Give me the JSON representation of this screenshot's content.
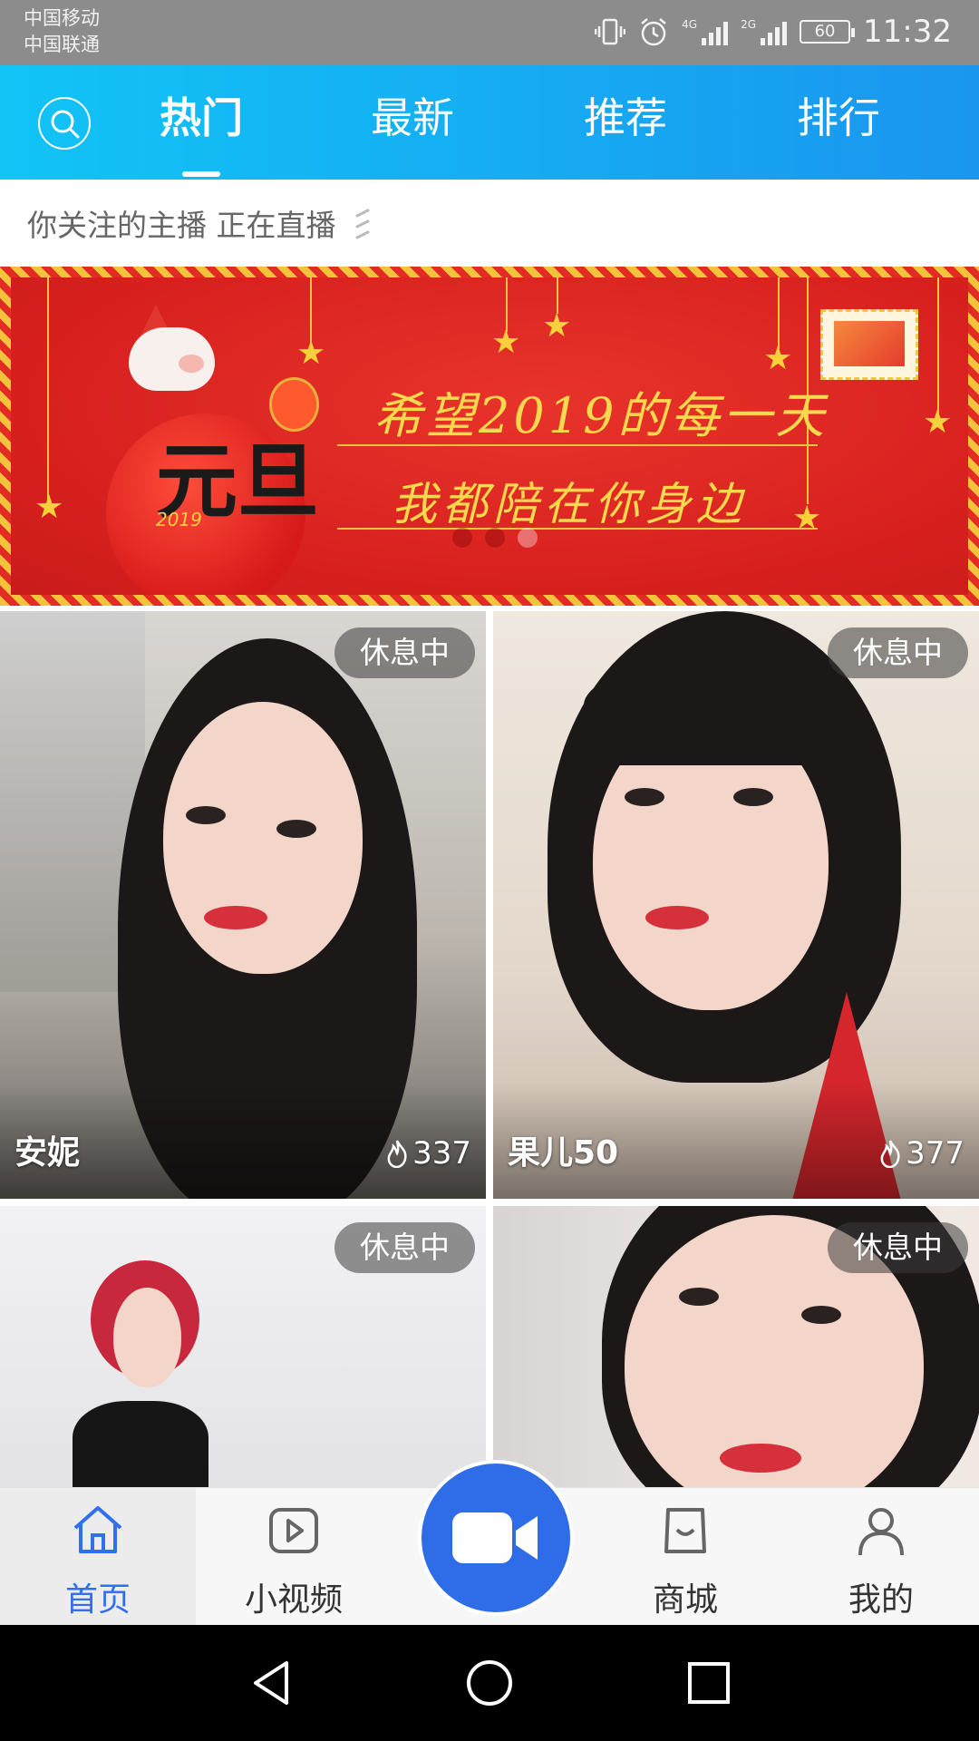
{
  "status_bar": {
    "carrier_1": "中国移动",
    "carrier_2": "中国联通",
    "network_1": "4G",
    "network_2": "2G",
    "battery": "60",
    "time": "11:32",
    "icons": [
      "vibrate-icon",
      "alarm-icon",
      "signal-4g-icon",
      "signal-2g-icon",
      "battery-icon"
    ]
  },
  "top_nav": {
    "tabs": [
      {
        "label": "热门",
        "active": true
      },
      {
        "label": "最新",
        "active": false
      },
      {
        "label": "推荐",
        "active": false
      },
      {
        "label": "排行",
        "active": false
      }
    ],
    "search_icon": "search-icon"
  },
  "follow_bar": {
    "text": "你关注的主播 正在直播"
  },
  "banner": {
    "line1": "希望2019的每一天",
    "line2": "我都陪在你身边",
    "badge_text": "元旦",
    "badge_year": "2019",
    "page_count": 3,
    "active_page": 2
  },
  "streamers": [
    {
      "name": "安妮",
      "status": "休息中",
      "heat": "337",
      "show_footer": true
    },
    {
      "name": "果儿50",
      "status": "休息中",
      "heat": "377",
      "show_footer": true
    },
    {
      "name": "",
      "status": "休息中",
      "heat": "",
      "show_footer": false
    },
    {
      "name": "",
      "status": "休息中",
      "heat": "",
      "show_footer": false
    }
  ],
  "bottom_tabs": [
    {
      "label": "首页",
      "icon": "home-icon",
      "active": true
    },
    {
      "label": "小视频",
      "icon": "play-video-icon",
      "active": false
    },
    {
      "label": "",
      "icon": "video-camera-icon",
      "active": false
    },
    {
      "label": "商城",
      "icon": "shopping-bag-icon",
      "active": false
    },
    {
      "label": "我的",
      "icon": "profile-icon",
      "active": false
    }
  ],
  "colors": {
    "nav_gradient_start": "#11c4f6",
    "nav_gradient_end": "#1a96ef",
    "accent_blue": "#2e6ce8",
    "banner_red": "#d7201e",
    "banner_gold": "#f8d84c"
  }
}
